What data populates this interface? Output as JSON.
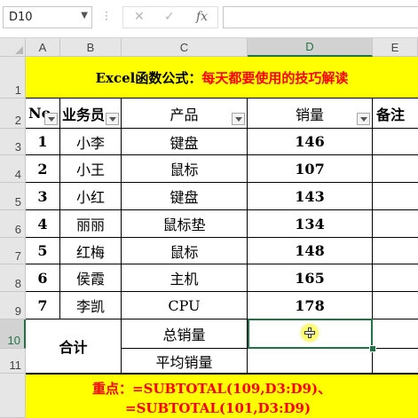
{
  "formula_bar": {
    "name_box": "D10",
    "fx_label": "fx",
    "cancel": "✕",
    "enter": "✓",
    "formula": ""
  },
  "columns": [
    "A",
    "B",
    "C",
    "D",
    "E"
  ],
  "rows": [
    "1",
    "2",
    "3",
    "4",
    "5",
    "6",
    "7",
    "8",
    "9",
    "10",
    "11"
  ],
  "title": {
    "prefix": "Excel函数公式：",
    "suffix": "每天都要使用的技巧解读"
  },
  "table": {
    "headers": [
      "No",
      "业务员",
      "产品",
      "销量",
      "备注"
    ],
    "data": [
      {
        "no": "1",
        "name": "小李",
        "product": "键盘",
        "sales": "146"
      },
      {
        "no": "2",
        "name": "小王",
        "product": "鼠标",
        "sales": "107"
      },
      {
        "no": "3",
        "name": "小红",
        "product": "键盘",
        "sales": "143"
      },
      {
        "no": "4",
        "name": "丽丽",
        "product": "鼠标垫",
        "sales": "134"
      },
      {
        "no": "5",
        "name": "红梅",
        "product": "鼠标",
        "sales": "148"
      },
      {
        "no": "6",
        "name": "侯霞",
        "product": "主机",
        "sales": "165"
      },
      {
        "no": "7",
        "name": "李凯",
        "product": "CPU",
        "sales": "178"
      }
    ],
    "total_label": "合计",
    "total_sales_label": "总销量",
    "avg_sales_label": "平均销量"
  },
  "note": {
    "line1": "重点：=SUBTOTAL(109,D3:D9)、",
    "line2": "=SUBTOTAL(101,D3:D9)"
  },
  "colors": {
    "highlight": "#ffff00",
    "title_red": "#ff0000",
    "selection": "#217346"
  }
}
